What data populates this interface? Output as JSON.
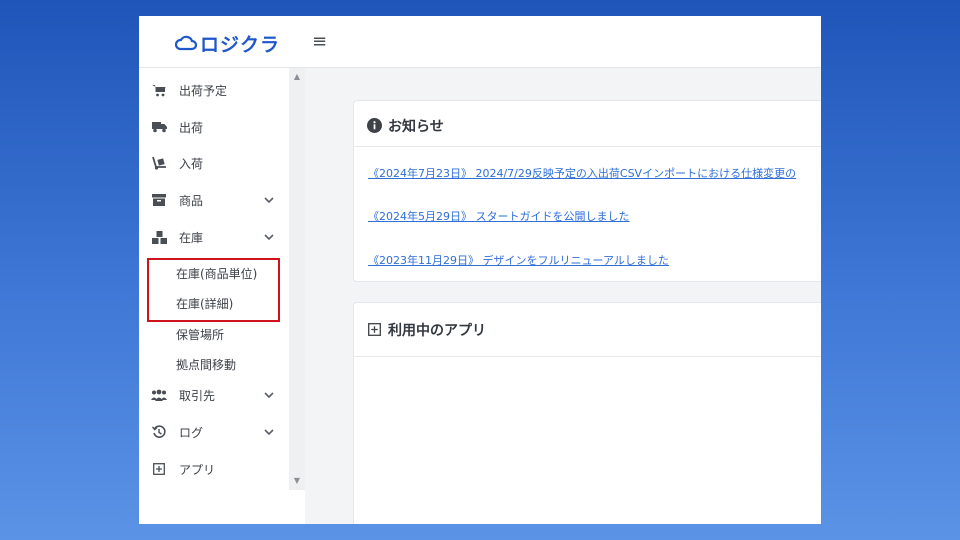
{
  "app": {
    "logo_text": "ロジクラ",
    "menu_glyph": "≡"
  },
  "sidebar": {
    "items": [
      {
        "label": "出荷予定",
        "icon": "cart-icon"
      },
      {
        "label": "出荷",
        "icon": "truck-icon"
      },
      {
        "label": "入荷",
        "icon": "dolly-icon"
      },
      {
        "label": "商品",
        "icon": "box-icon"
      },
      {
        "label": "在庫",
        "icon": "boxes-icon"
      },
      {
        "label": "取引先",
        "icon": "users-icon"
      },
      {
        "label": "ログ",
        "icon": "history-icon"
      },
      {
        "label": "アプリ",
        "icon": "plus-square-icon"
      }
    ],
    "inventory_sub": [
      {
        "label": "在庫(商品単位)"
      },
      {
        "label": "在庫(詳細)"
      },
      {
        "label": "保管場所"
      },
      {
        "label": "拠点間移動"
      }
    ]
  },
  "announcements": {
    "title": "お知らせ",
    "items": [
      {
        "text": "《2024年7月23日》 2024/7/29反映予定の入出荷CSVインポートにおける仕様変更の"
      },
      {
        "text": "《2024年5月29日》 スタートガイドを公開しました"
      },
      {
        "text": "《2023年11月29日》 デザインをフルリニューアルしました"
      }
    ]
  },
  "apps_in_use": {
    "title": "利用中のアプリ"
  },
  "colors": {
    "accent": "#1f56c9",
    "link": "#2f6fd8",
    "highlight_border": "#d0121b"
  }
}
